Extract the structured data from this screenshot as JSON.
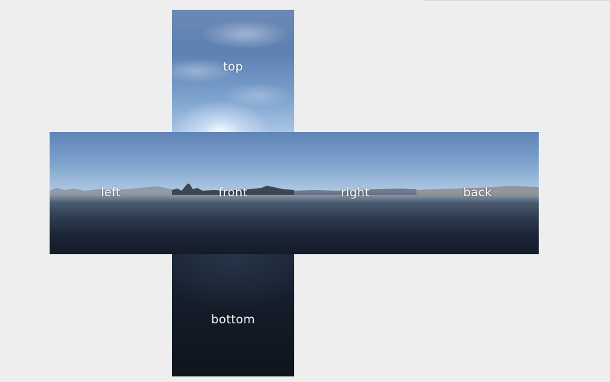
{
  "cubemap": {
    "faces": {
      "top": "top",
      "left": "left",
      "front": "front",
      "right": "right",
      "back": "back",
      "bottom": "bottom"
    }
  }
}
